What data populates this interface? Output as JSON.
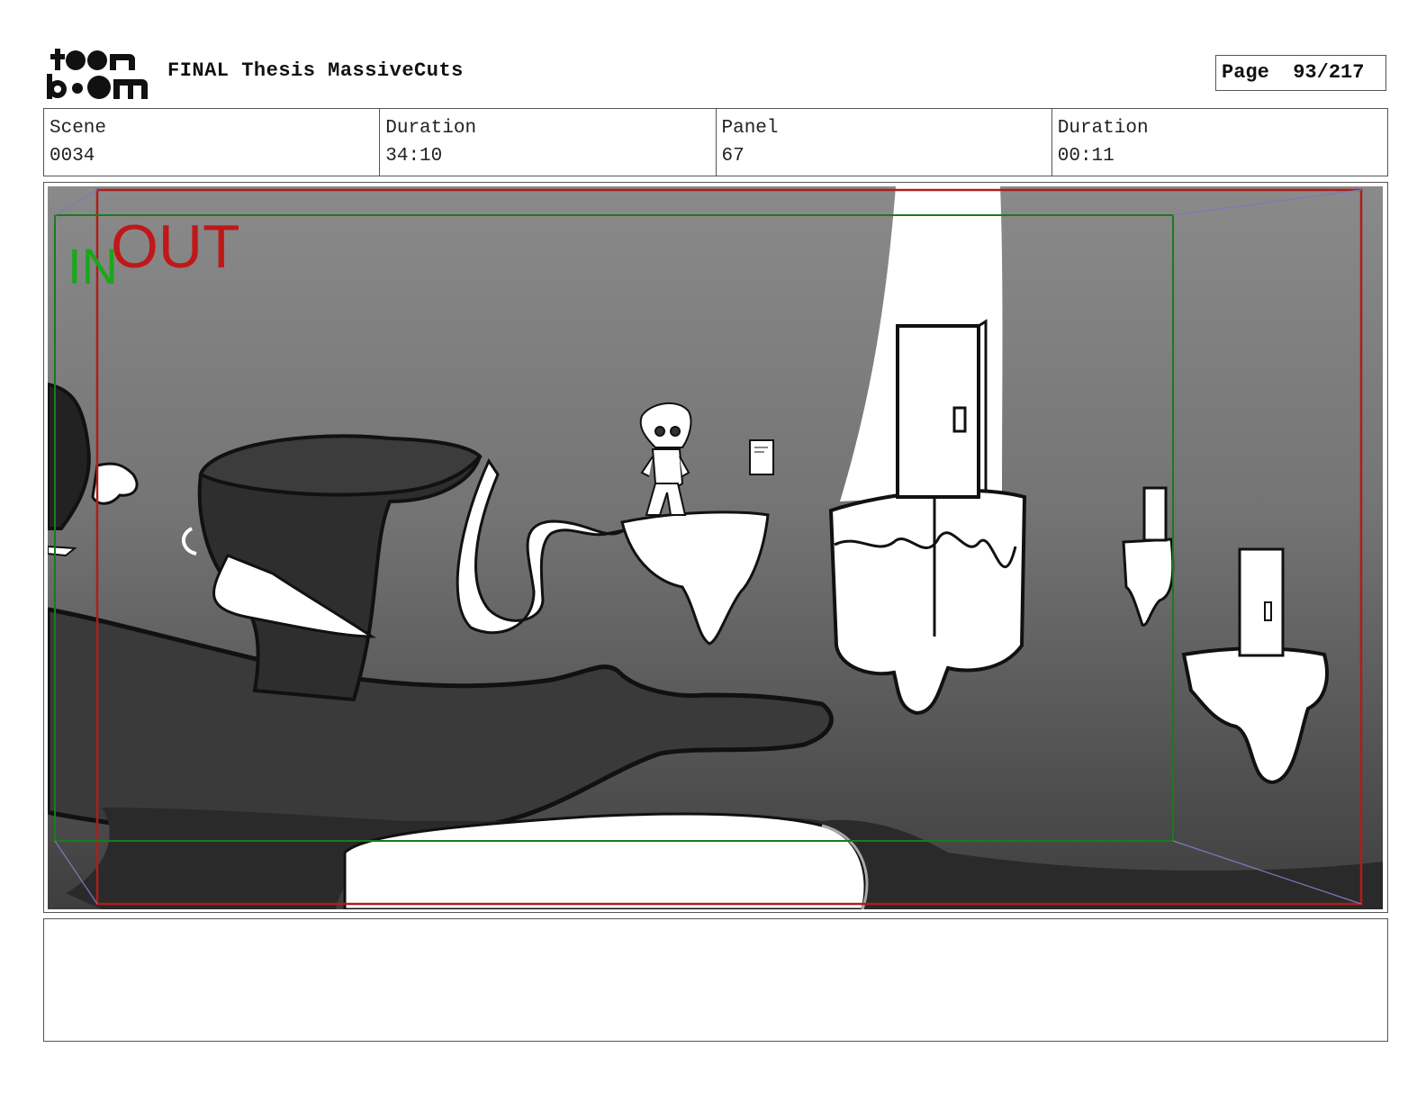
{
  "header": {
    "logo_alt": "toon boom",
    "project_title": "FINAL Thesis MassiveCuts",
    "page_label": "Page",
    "page_value": "93/217"
  },
  "info": {
    "scene_label": "Scene",
    "scene_value": "0034",
    "duration_label": "Duration",
    "duration_value": "34:10",
    "panel_label": "Panel",
    "panel_value": "67",
    "panel_duration_label": "Duration",
    "panel_duration_value": "00:11"
  },
  "frame": {
    "in_label": "IN",
    "out_label": "OUT",
    "in_color": "#1aa81a",
    "out_color": "#c01818"
  },
  "notes": {
    "text": ""
  }
}
